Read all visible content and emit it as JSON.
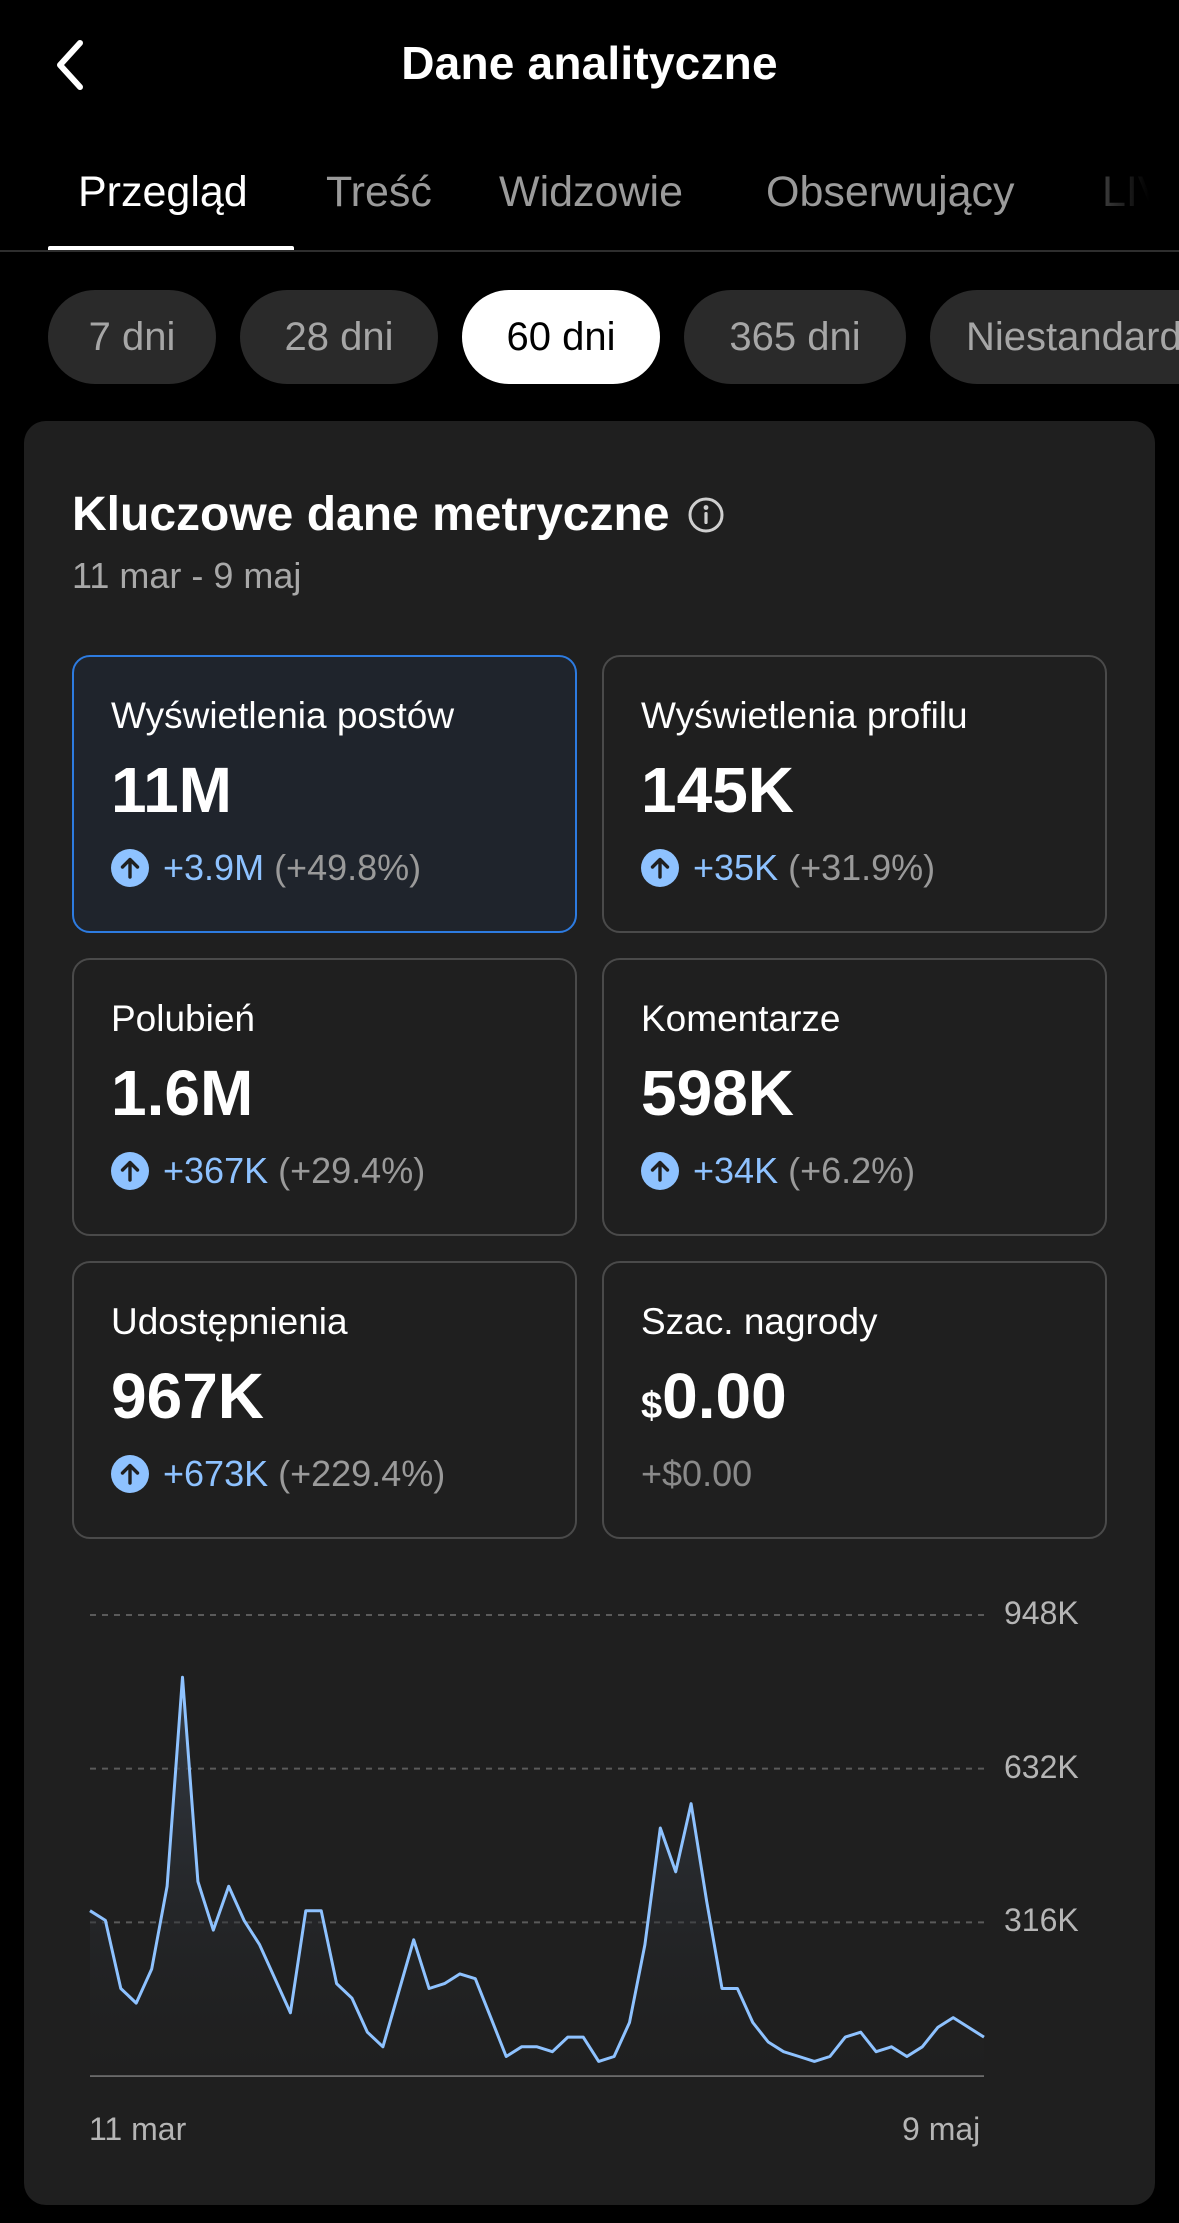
{
  "header": {
    "title": "Dane analityczne",
    "back_icon": "chevron-left-icon"
  },
  "tabs": [
    {
      "label": "Przegląd",
      "active": true
    },
    {
      "label": "Treść",
      "active": false
    },
    {
      "label": "Widzowie",
      "active": false
    },
    {
      "label": "Obserwujący",
      "active": false
    },
    {
      "label": "LIVE",
      "active": false
    }
  ],
  "ranges": [
    {
      "label": "7 dni",
      "active": false
    },
    {
      "label": "28 dni",
      "active": false
    },
    {
      "label": "60 dni",
      "active": true
    },
    {
      "label": "365 dni",
      "active": false
    },
    {
      "label": "Niestandardowy",
      "active": false
    }
  ],
  "card": {
    "title": "Kluczowe dane metryczne",
    "range": "11 mar - 9 maj",
    "info_icon": "info-icon"
  },
  "metrics": [
    {
      "label": "Wyświetlenia postów",
      "value": "11M",
      "delta": "+3.9M",
      "delta_pct": "(+49.8%)",
      "selected": true
    },
    {
      "label": "Wyświetlenia profilu",
      "value": "145K",
      "delta": "+35K",
      "delta_pct": "(+31.9%)",
      "selected": false
    },
    {
      "label": "Polubień",
      "value": "1.6M",
      "delta": "+367K",
      "delta_pct": "(+29.4%)",
      "selected": false
    },
    {
      "label": "Komentarze",
      "value": "598K",
      "delta": "+34K",
      "delta_pct": "(+6.2%)",
      "selected": false
    },
    {
      "label": "Udostępnienia",
      "value": "967K",
      "delta": "+673K",
      "delta_pct": "(+229.4%)",
      "selected": false
    },
    {
      "label": "Szac. nagrody",
      "currency": "$",
      "value": "0.00",
      "delta": "+$0.00",
      "delta_pct": "",
      "selected": false
    }
  ],
  "colors": {
    "accent": "#8ec2ff",
    "selected_border": "#2d7be0",
    "card_bg": "#1f1f1f"
  },
  "chart_data": {
    "type": "area",
    "x_start_label": "11 mar",
    "x_end_label": "9 maj",
    "y_tick_labels": [
      "948K",
      "632K",
      "316K"
    ],
    "ylim": [
      0,
      948000
    ],
    "grid": true,
    "series": [
      {
        "values": [
          340000,
          320000,
          180000,
          150000,
          220000,
          390000,
          820000,
          400000,
          300000,
          390000,
          320000,
          270000,
          200000,
          130000,
          340000,
          340000,
          190000,
          160000,
          90000,
          60000,
          170000,
          280000,
          180000,
          190000,
          210000,
          200000,
          120000,
          40000,
          60000,
          60000,
          50000,
          80000,
          80000,
          30000,
          40000,
          110000,
          270000,
          510000,
          420000,
          560000,
          360000,
          180000,
          180000,
          110000,
          70000,
          50000,
          40000,
          30000,
          40000,
          80000,
          90000,
          50000,
          60000,
          40000,
          60000,
          100000,
          120000,
          100000,
          80000
        ]
      }
    ]
  }
}
